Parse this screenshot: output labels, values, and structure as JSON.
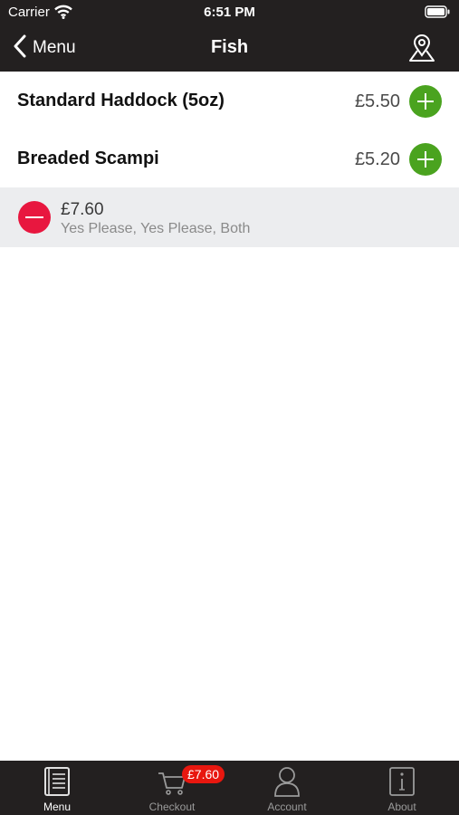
{
  "status": {
    "carrier": "Carrier",
    "time": "6:51 PM"
  },
  "nav": {
    "back_label": "Menu",
    "title": "Fish"
  },
  "items": [
    {
      "name": "Standard Haddock (5oz)",
      "price": "£5.50"
    },
    {
      "name": "Breaded Scampi",
      "price": "£5.20"
    }
  ],
  "selection": {
    "price": "£7.60",
    "options": "Yes Please, Yes Please, Both"
  },
  "tabs": [
    {
      "label": "Menu",
      "icon": "menu-book-icon",
      "active": true
    },
    {
      "label": "Checkout",
      "icon": "cart-icon",
      "badge": "£7.60"
    },
    {
      "label": "Account",
      "icon": "user-icon"
    },
    {
      "label": "About",
      "icon": "info-icon"
    }
  ],
  "colors": {
    "bar": "#232020",
    "add": "#4aa31f",
    "remove": "#e8173f",
    "badge": "#e8170f"
  }
}
